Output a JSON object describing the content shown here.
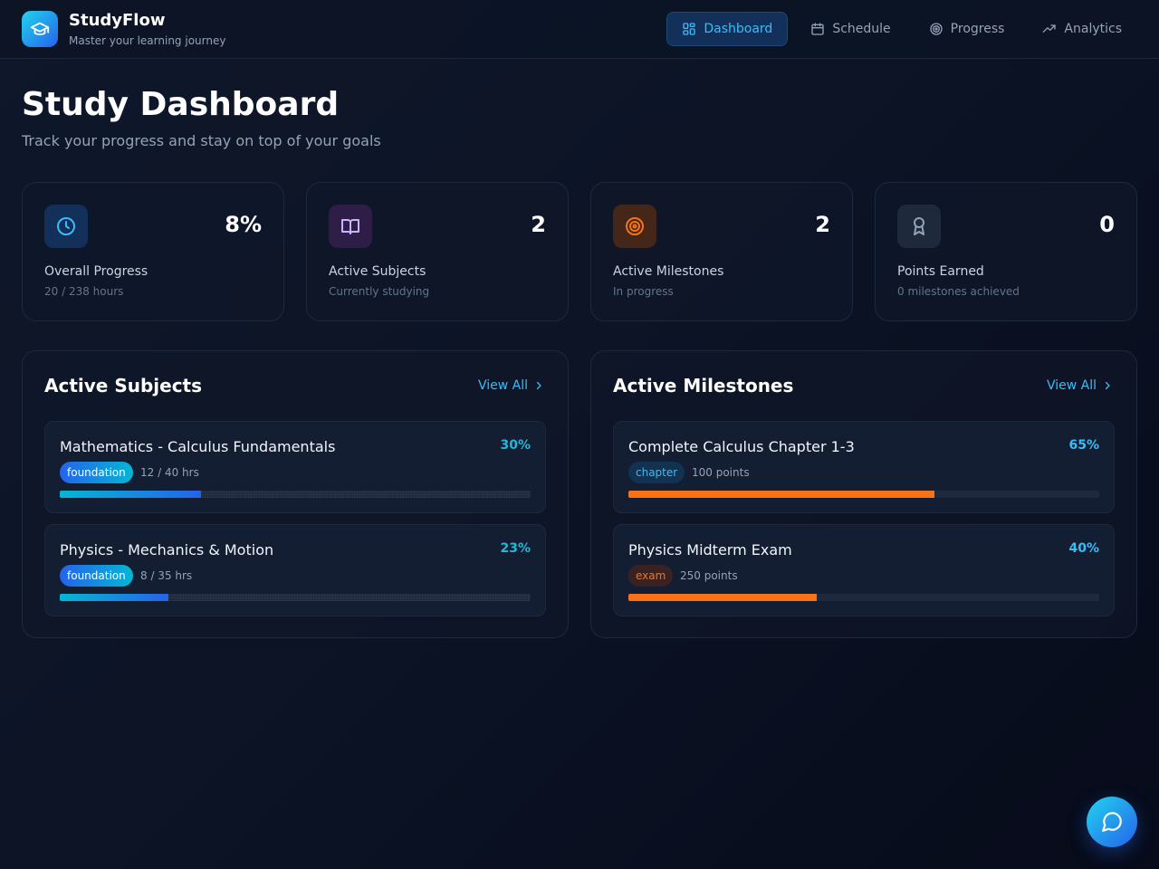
{
  "app": {
    "name": "StudyFlow",
    "tagline": "Master your learning journey"
  },
  "nav": [
    {
      "label": "Dashboard",
      "icon": "grid-icon",
      "active": true
    },
    {
      "label": "Schedule",
      "icon": "calendar-icon",
      "active": false
    },
    {
      "label": "Progress",
      "icon": "target-icon",
      "active": false
    },
    {
      "label": "Analytics",
      "icon": "trending-up-icon",
      "active": false
    }
  ],
  "page": {
    "title": "Study Dashboard",
    "subtitle": "Track your progress and stay on top of your goals"
  },
  "stats": [
    {
      "value": "8%",
      "label": "Overall Progress",
      "sub": "20 / 238 hours",
      "icon": "clock-icon",
      "accent": "#38bdf8"
    },
    {
      "value": "2",
      "label": "Active Subjects",
      "sub": "Currently studying",
      "icon": "book-icon",
      "accent": "#c4b5fd"
    },
    {
      "value": "2",
      "label": "Active Milestones",
      "sub": "In progress",
      "icon": "target-icon",
      "accent": "#f97316"
    },
    {
      "value": "0",
      "label": "Points Earned",
      "sub": "0 milestones achieved",
      "icon": "award-icon",
      "accent": "#94a3b8"
    }
  ],
  "subjects_panel": {
    "title": "Active Subjects",
    "view_all": "View All",
    "items": [
      {
        "title": "Mathematics - Calculus Fundamentals",
        "percent_label": "30%",
        "progress": 0.3,
        "tag": "foundation",
        "meta": "12 / 40 hrs"
      },
      {
        "title": "Physics - Mechanics & Motion",
        "percent_label": "23%",
        "progress": 0.23,
        "tag": "foundation",
        "meta": "8 / 35 hrs"
      }
    ]
  },
  "milestones_panel": {
    "title": "Active Milestones",
    "view_all": "View All",
    "items": [
      {
        "title": "Complete Calculus Chapter 1-3",
        "percent_label": "65%",
        "progress": 0.65,
        "tag": "chapter",
        "meta": "100 points"
      },
      {
        "title": "Physics Midterm Exam",
        "percent_label": "40%",
        "progress": 0.4,
        "tag": "exam",
        "meta": "250 points"
      }
    ]
  },
  "colors": {
    "accent_blue": "#38bdf8",
    "accent_orange": "#f97316",
    "background": "#0c1426"
  }
}
